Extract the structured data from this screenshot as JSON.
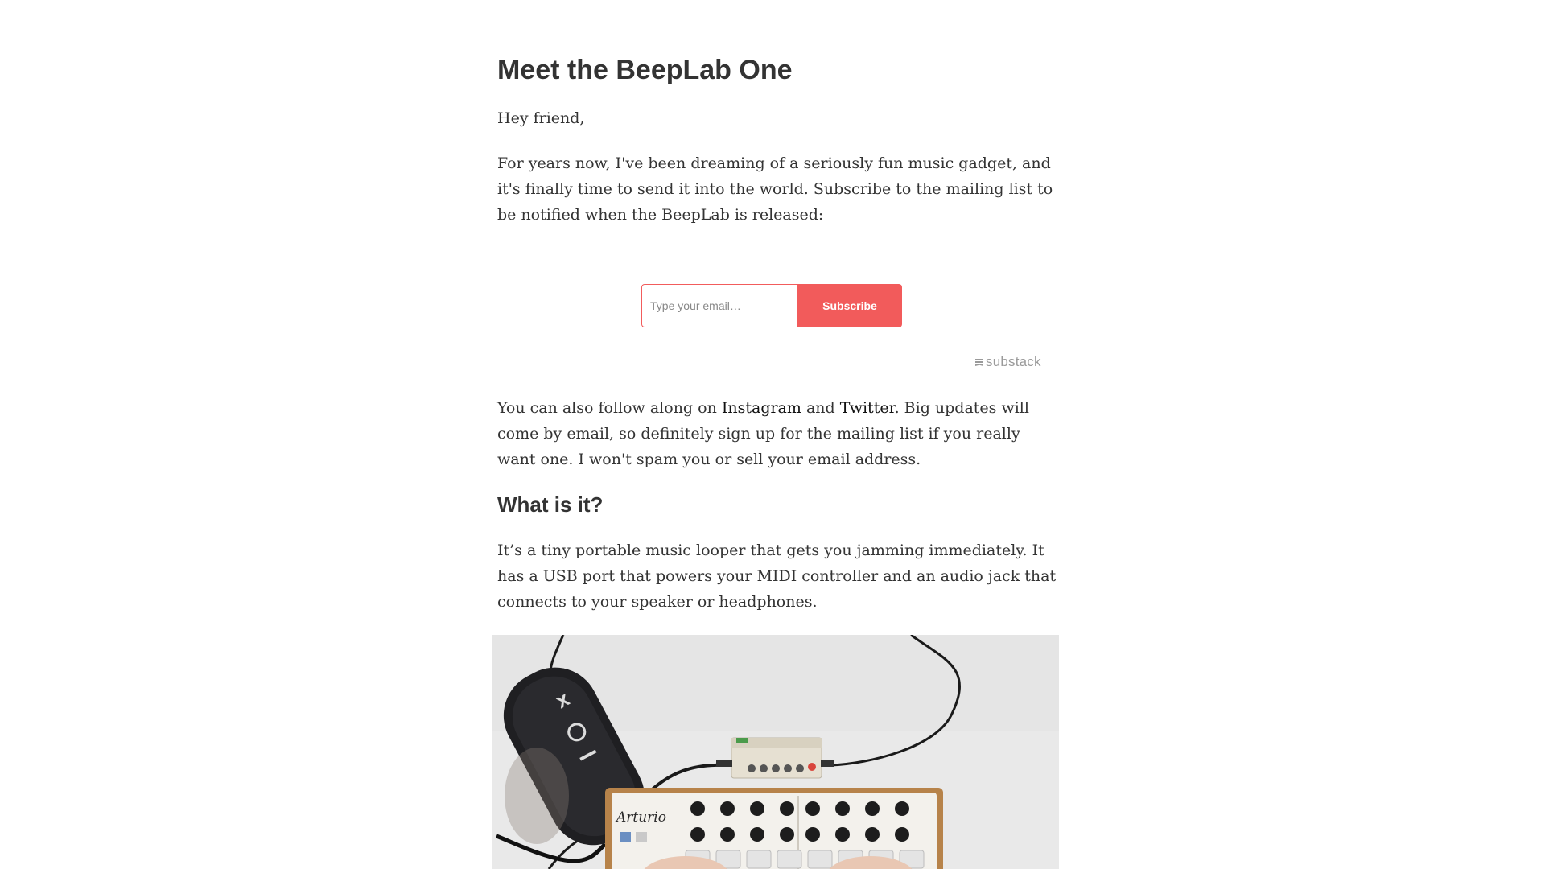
{
  "article": {
    "title": "Meet the BeepLab One",
    "greeting": "Hey friend,",
    "intro": "For years now, I've been dreaming of a seriously fun music gadget, and it's finally time to send it into the world. Subscribe to the mailing list to be notified when the BeepLab is released:",
    "follow_prefix": "You can also follow along on ",
    "instagram_link": "Instagram",
    "follow_and": " and ",
    "twitter_link": "Twitter",
    "follow_suffix": ". Big updates will come by email, so definitely sign up for the mailing list if you really want one. I won't spam you or sell your email address.",
    "section_heading": "What is it?",
    "description": "It’s a tiny portable music looper that gets you jamming immediately. It has a USB port that powers your MIDI controller and an audio jack that connects to your speaker or headphones."
  },
  "subscribe": {
    "placeholder": "Type your email…",
    "value": "",
    "button_label": "Subscribe",
    "badge_label": "substack",
    "badge_icon": "substack-logo-icon",
    "accent_color": "#f25b5b"
  },
  "photo": {
    "brand_label": "Arturio"
  }
}
